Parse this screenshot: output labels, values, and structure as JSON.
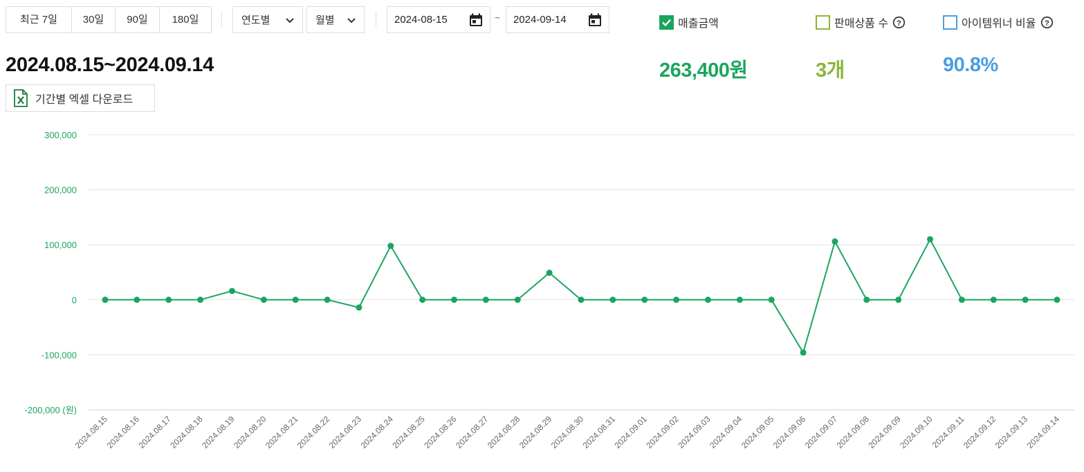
{
  "controls": {
    "period_buttons": [
      "최근 7일",
      "30일",
      "90일",
      "180일"
    ],
    "year_dropdown": "연도별",
    "month_dropdown": "월별",
    "start_date": "2024-08-15",
    "end_date": "2024-09-14",
    "range_sep": "~"
  },
  "metrics": [
    {
      "label": "매출금액",
      "value": "263,400원",
      "checked": true,
      "color": "#1aa55f",
      "help": false
    },
    {
      "label": "판매상품 수",
      "value": "3개",
      "checked": false,
      "color": "#8bb53a",
      "help": true
    },
    {
      "label": "아이템위너 비율",
      "value": "90.8%",
      "checked": false,
      "color": "#4a9ee0",
      "help": true
    }
  ],
  "range_title": "2024.08.15~2024.09.14",
  "excel_button": "기간별 엑셀 다운로드",
  "chart_data": {
    "type": "line",
    "x": [
      "2024.08.15",
      "2024.08.16",
      "2024.08.17",
      "2024.08.18",
      "2024.08.19",
      "2024.08.20",
      "2024.08.21",
      "2024.08.22",
      "2024.08.23",
      "2024.08.24",
      "2024.08.25",
      "2024.08.26",
      "2024.08.27",
      "2024.08.28",
      "2024.08.29",
      "2024.08.30",
      "2024.08.31",
      "2024.09.01",
      "2024.09.02",
      "2024.09.03",
      "2024.09.04",
      "2024.09.05",
      "2024.09.06",
      "2024.09.07",
      "2024.09.08",
      "2024.09.09",
      "2024.09.10",
      "2024.09.11",
      "2024.09.12",
      "2024.09.13",
      "2024.09.14"
    ],
    "series": [
      {
        "values": [
          0,
          0,
          0,
          0,
          16000,
          0,
          0,
          0,
          -14000,
          98000,
          0,
          0,
          0,
          0,
          49000,
          0,
          0,
          0,
          0,
          0,
          0,
          0,
          -96000,
          106000,
          0,
          0,
          110000,
          0,
          0,
          0,
          0
        ],
        "color": "#1aa55f"
      }
    ],
    "yticks": [
      "300,000",
      "200,000",
      "100,000",
      "0",
      "-100,000",
      "-200,000 (원)"
    ],
    "ytick_values": [
      300000,
      200000,
      100000,
      0,
      -100000,
      -200000
    ],
    "ylim": [
      -200000,
      300000
    ],
    "grid": true
  }
}
